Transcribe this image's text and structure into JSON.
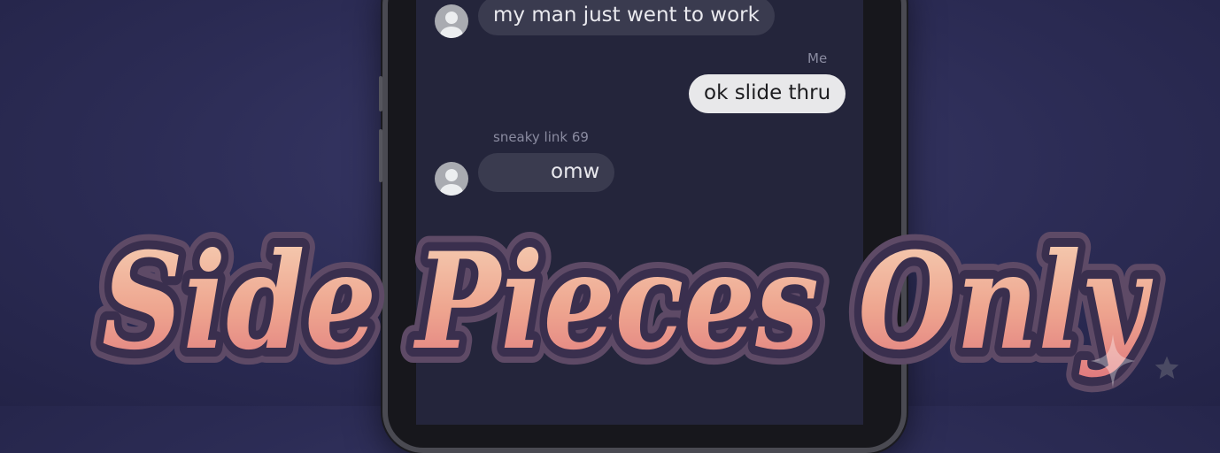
{
  "conversation": {
    "messages": [
      {
        "sender": "them",
        "text": "my man just went to work"
      },
      {
        "sender": "me",
        "sender_label": "Me",
        "text": "ok slide thru"
      },
      {
        "sender": "them",
        "sender_label": "sneaky link 69",
        "text": "omw"
      }
    ]
  },
  "title": {
    "text": "Side Pieces Only"
  },
  "colors": {
    "background": "#2c2c55",
    "title_fill_top": "#f6d2b6",
    "title_fill_bottom": "#e07a7e",
    "title_outline": "#3a2f4e",
    "incoming_bubble": "#3a3b4f",
    "outgoing_bubble": "#e8e8ea"
  },
  "icons": [
    "contact-avatar-icon",
    "sparkle-icon",
    "star-icon"
  ]
}
